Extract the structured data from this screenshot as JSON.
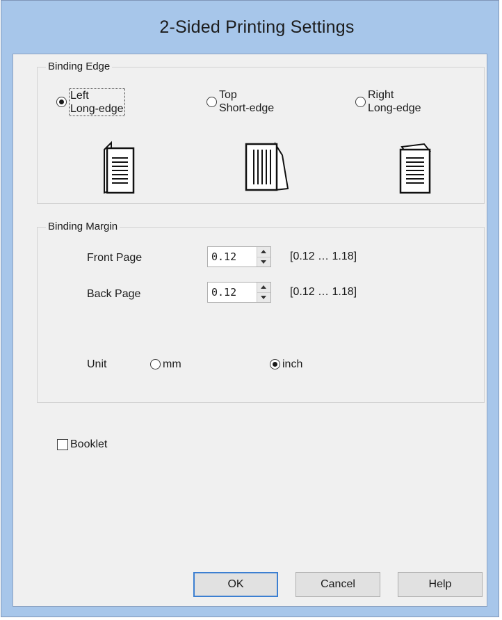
{
  "window": {
    "title": "2-Sided Printing Settings",
    "colors": {
      "frame": "#a7c6ea",
      "client": "#f0f0f0",
      "accent": "#3c7fd1"
    }
  },
  "binding_edge": {
    "label": "Binding Edge",
    "options": [
      {
        "line1": "Left",
        "line2": "Long-edge",
        "selected": true,
        "icon": "left-binding-page-icon"
      },
      {
        "line1": "Top",
        "line2": "Short-edge",
        "selected": false,
        "icon": "top-binding-page-icon"
      },
      {
        "line1": "Right",
        "line2": "Long-edge",
        "selected": false,
        "icon": "right-binding-page-icon"
      }
    ]
  },
  "binding_margin": {
    "label": "Binding Margin",
    "front_page": {
      "label": "Front Page",
      "value": "0.12",
      "range": "[0.12 … 1.18]"
    },
    "back_page": {
      "label": "Back Page",
      "value": "0.12",
      "range": "[0.12 … 1.18]"
    },
    "unit": {
      "label": "Unit",
      "options": [
        {
          "label": "mm",
          "selected": false
        },
        {
          "label": "inch",
          "selected": true
        }
      ]
    }
  },
  "booklet": {
    "label": "Booklet",
    "checked": false
  },
  "buttons": {
    "ok": "OK",
    "cancel": "Cancel",
    "help": "Help"
  }
}
